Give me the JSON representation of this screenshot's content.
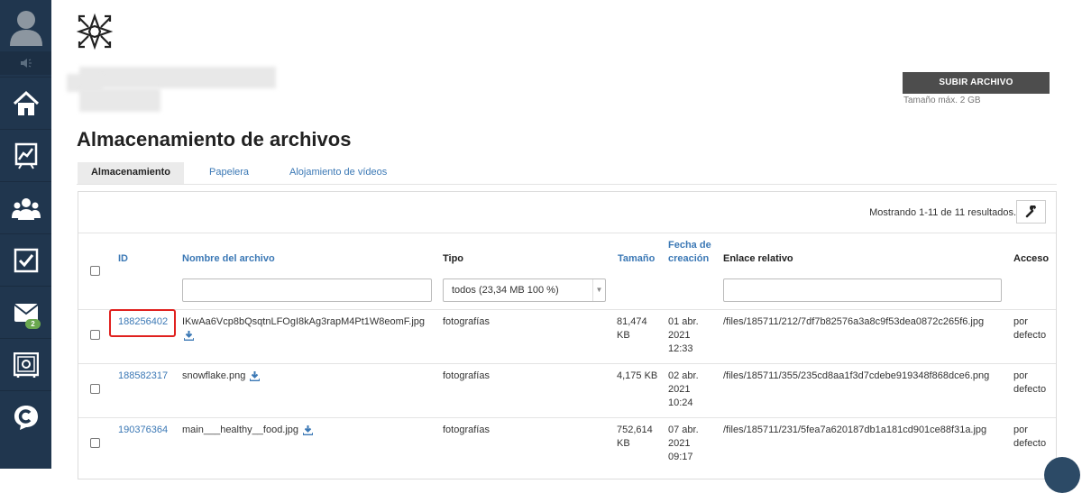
{
  "sidebar": {
    "items": [
      {
        "name": "home",
        "icon": "home-icon"
      },
      {
        "name": "statistics",
        "icon": "chart-icon"
      },
      {
        "name": "contacts",
        "icon": "users-icon"
      },
      {
        "name": "tasks",
        "icon": "checkbox-icon"
      },
      {
        "name": "email",
        "icon": "mail-icon",
        "badge": "2"
      },
      {
        "name": "storage",
        "icon": "safe-icon"
      },
      {
        "name": "chat",
        "icon": "chat-bubble-icon"
      }
    ]
  },
  "header": {
    "upload_label": "SUBIR ARCHIVO",
    "max_size": "Tamaño máx. 2 GB",
    "title": "Almacenamiento de archivos"
  },
  "tabs": [
    {
      "label": "Almacenamiento",
      "active": true
    },
    {
      "label": "Papelera",
      "active": false
    },
    {
      "label": "Alojamiento de vídeos",
      "active": false
    }
  ],
  "table": {
    "results_text": "Mostrando 1-11 de 11 resultados.",
    "columns": {
      "id": "ID",
      "name": "Nombre del archivo",
      "type": "Tipo",
      "size": "Tamaño",
      "date_line1": "Fecha de",
      "date_line2": "creación",
      "link": "Enlace relativo",
      "access": "Acceso"
    },
    "type_filter": "todos (23,34 MB 100 %)",
    "rows": [
      {
        "id": "188256402",
        "name": "IKwAa6Vcp8bQsqtnLFOgI8kAg3rapM4Pt1W8eomF.jpg",
        "type": "fotografías",
        "size_line1": "81,474",
        "size_line2": "KB",
        "date_line1": "01 abr.",
        "date_line2": "2021",
        "date_line3": "12:33",
        "link": "/files/185711/212/7df7b82576a3a8c9f53dea0872c265f6.jpg",
        "access_line1": "por",
        "access_line2": "defecto"
      },
      {
        "id": "188582317",
        "name": "snowflake.png",
        "type": "fotografías",
        "size_line1": "4,175 KB",
        "size_line2": "",
        "date_line1": "02 abr.",
        "date_line2": "2021",
        "date_line3": "10:24",
        "link": "/files/185711/355/235cd8aa1f3d7cdebe919348f868dce6.png",
        "access_line1": "por",
        "access_line2": "defecto"
      },
      {
        "id": "190376364",
        "name": "main___healthy__food.jpg",
        "type": "fotografías",
        "size_line1": "752,614",
        "size_line2": "KB",
        "date_line1": "07 abr.",
        "date_line2": "2021",
        "date_line3": "09:17",
        "link": "/files/185711/231/5fea7a620187db1a181cd901ce88f31a.jpg",
        "access_line1": "por",
        "access_line2": "defecto"
      }
    ]
  },
  "colors": {
    "sidebar_bg": "#20364e",
    "link": "#3b78b5",
    "highlight": "#e0211f",
    "badge": "#6aa84f"
  }
}
